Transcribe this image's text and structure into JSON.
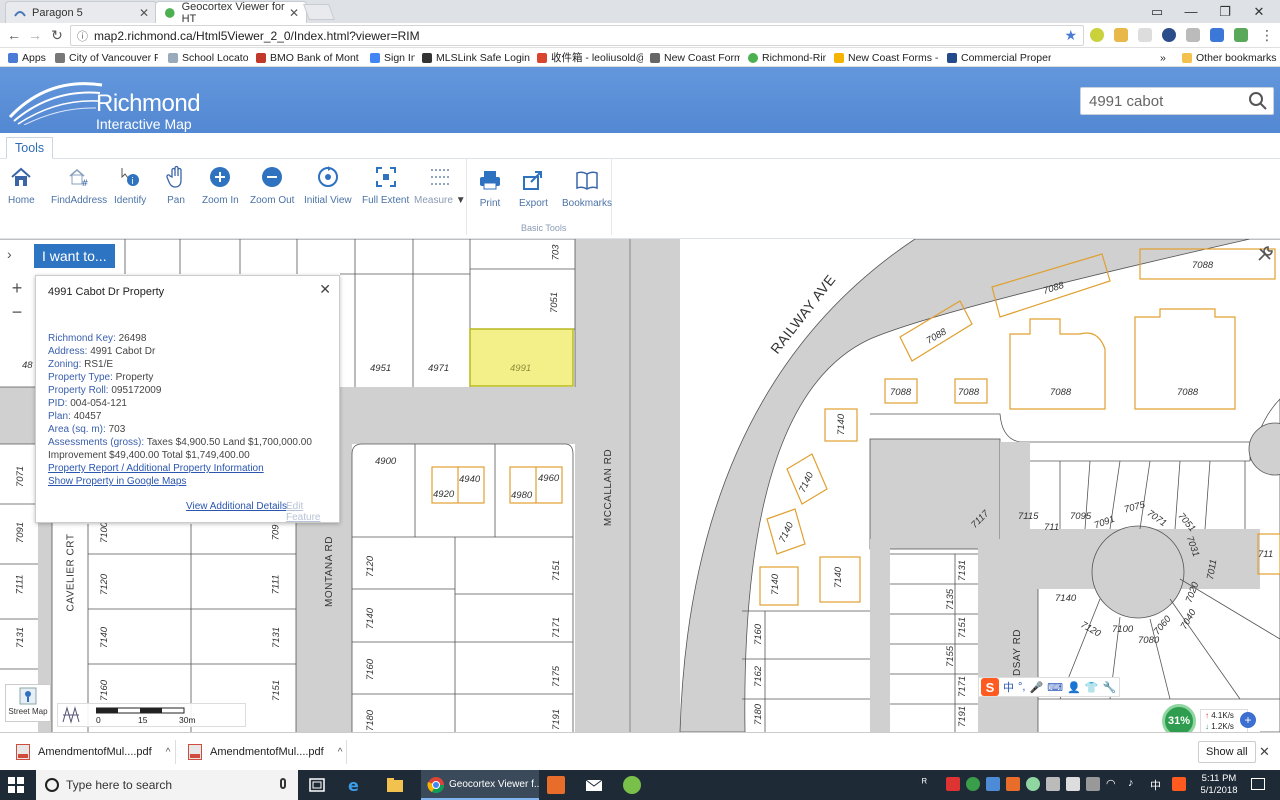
{
  "browser": {
    "tabs": [
      {
        "title": "Paragon 5",
        "active": false
      },
      {
        "title": "Geocortex Viewer for HT",
        "active": true
      }
    ],
    "url": "map2.richmond.ca/Html5Viewer_2_0/Index.html?viewer=RIM",
    "bookmarks": [
      "Apps",
      "City of Vancouver Pub",
      "School Locator",
      "BMO Bank of Montre",
      "Sign In",
      "MLSLink Safe Login P",
      "收件箱 - leoliusold@",
      "New Coast Forms",
      "Richmond-Rim",
      "New Coast Forms - G",
      "Commercial Property"
    ],
    "bookmarks_more": "»",
    "other_bookmarks": "Other bookmarks"
  },
  "app": {
    "logo_line1": "Richmond",
    "logo_line2": "Interactive Map",
    "search_value": "4991 cabot",
    "ribbon_tab": "Tools",
    "tools": [
      {
        "label": "Home",
        "icon": "home-icon"
      },
      {
        "label": "FindAddress",
        "icon": "find-address-icon"
      },
      {
        "label": "Identify",
        "icon": "identify-icon"
      },
      {
        "label": "Pan",
        "icon": "hand-icon"
      },
      {
        "label": "Zoom In",
        "icon": "zoom-in-icon"
      },
      {
        "label": "Zoom Out",
        "icon": "zoom-out-icon"
      },
      {
        "label": "Initial View",
        "icon": "initial-view-icon"
      },
      {
        "label": "Full Extent",
        "icon": "full-extent-icon"
      },
      {
        "label": "Measure",
        "icon": "measure-icon"
      },
      {
        "label": "Print",
        "icon": "print-icon"
      },
      {
        "label": "Export",
        "icon": "export-icon"
      },
      {
        "label": "Bookmarks",
        "icon": "bookmarks-icon"
      }
    ],
    "group_label": "Basic Tools",
    "iwant": "I want to..."
  },
  "popup": {
    "title": "4991 Cabot Dr Property",
    "rows": [
      {
        "k": "Richmond Key:",
        "v": "26498"
      },
      {
        "k": "Address:",
        "v": "4991 Cabot Dr"
      },
      {
        "k": "Zoning:",
        "v": "RS1/E"
      },
      {
        "k": "Property Type:",
        "v": "Property"
      },
      {
        "k": "Property Roll:",
        "v": "095172009"
      },
      {
        "k": "PID:",
        "v": "004-054-121"
      },
      {
        "k": "Plan:",
        "v": "40457"
      },
      {
        "k": "Area (sq. m):",
        "v": "703"
      },
      {
        "k": "Assessments (gross):",
        "v": "Taxes $4,900.50 Land $1,700,000.00"
      }
    ],
    "improvement_line": "Improvement $49,400.00 Total $1,749,400.00",
    "link1": "Property Report / Additional Property Information",
    "link2": "Show Property in Google Maps",
    "view_details": "View Additional Details",
    "edit_feature": "Edit Feature"
  },
  "map": {
    "streets": {
      "railway": "RAILWAY AVE",
      "mccallan": "MCCALLAN RD",
      "montana": "MONTANA RD",
      "cavelier": "CAVELIER CRT",
      "lindsay": "DSAY RD"
    },
    "lots": {
      "l4951": "4951",
      "l4971": "4971",
      "l4991": "4991",
      "l48": "48",
      "l703": "703",
      "l7051": "7051",
      "l4900": "4900",
      "l4940": "4940",
      "l4920": "4920",
      "l4960": "4960",
      "l4980": "4980",
      "l7071": "7071",
      "l7091": "7091",
      "l7111": "7111",
      "l7131": "7131",
      "l7100": "7100",
      "l7120": "7120",
      "l7140": "7140",
      "l7160": "7160",
      "l709": "709",
      "l7151": "7151",
      "l7171": "7171",
      "l7175": "7175",
      "l7191": "7191",
      "l7180": "7180",
      "l7088": "7088",
      "l7117": "7117",
      "l7115": "7115",
      "l7095": "7095",
      "l7075": "7075",
      "l7051b": "7051",
      "l7031": "7031",
      "l7011": "7011",
      "l7020": "7020",
      "l7040": "7040",
      "l7060": "7060",
      "l7080": "7080",
      "l7135": "7135",
      "l7155": "7155",
      "l7162": "7162",
      "l7111b": "711"
    },
    "scale": {
      "s0": "0",
      "s15": "15",
      "s30": "30m"
    },
    "street_map": "Street Map"
  },
  "network": {
    "percent": "31%",
    "up": "4.1K/s",
    "down": "1.2K/s"
  },
  "downloads": {
    "items": [
      "AmendmentofMul....pdf",
      "AmendmentofMul....pdf"
    ],
    "show_all": "Show all"
  },
  "taskbar": {
    "search_placeholder": "Type here to search",
    "active_app": "Geocortex Viewer f...",
    "time": "5:11 PM",
    "date": "5/1/2018"
  }
}
